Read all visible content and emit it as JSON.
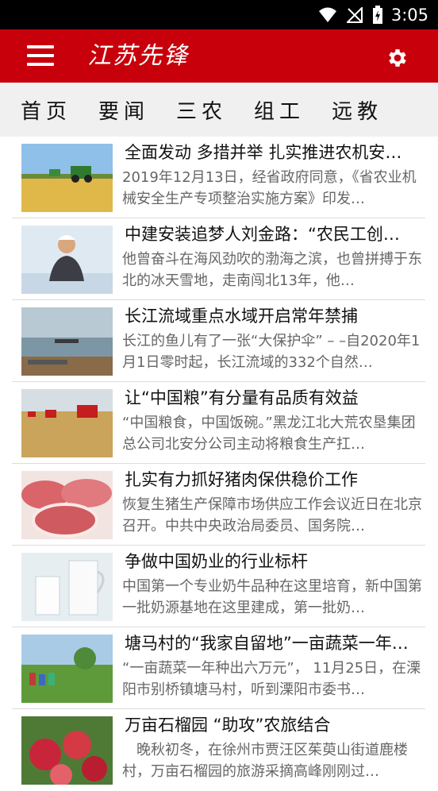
{
  "status_bar": {
    "time": "3:05"
  },
  "app_bar": {
    "logo_text": "江苏先锋"
  },
  "tabs": [
    {
      "label": "首页"
    },
    {
      "label": "要闻"
    },
    {
      "label": "三农"
    },
    {
      "label": "组工"
    },
    {
      "label": "远教"
    }
  ],
  "news": [
    {
      "title": "全面发动 多措并举 扎实推进农机安…",
      "summary": "2019年12月13日，经省政府同意，《省农业机械安全生产专项整治实施方案》印发…",
      "image": "wheat-harvest-image"
    },
    {
      "title": "中建安装追梦人刘金路：“农民工创…",
      "summary": "他曾奋斗在海风劲吹的渤海之滨，也曾拼搏于东北的冰天雪地，走南闯北13年，他…",
      "image": "worker-portrait-image"
    },
    {
      "title": "长江流域重点水域开启常年禁捕",
      "summary": "长江的鱼儿有了一张“大保护伞” – –自2020年1月1日零时起，长江流域的332个自然…",
      "image": "yangtze-river-image"
    },
    {
      "title": "让“中国粮”有分量有品质有效益",
      "summary": "“中国粮食，中国饭碗。”黑龙江北大荒农垦集团总公司北安分公司主动将粮食生产扛…",
      "image": "combine-harvesters-image"
    },
    {
      "title": "扎实有力抓好猪肉保供稳价工作",
      "summary": "恢复生猪生产保障市场供应工作会议近日在北京召开。中共中央政治局委员、国务院…",
      "image": "pork-slices-image"
    },
    {
      "title": "争做中国奶业的行业标杆",
      "summary": "中国第一个专业奶牛品种在这里培育，新中国第一批奶源基地在这里建成，第一批奶…",
      "image": "milk-glasses-image"
    },
    {
      "title": "塘马村的“我家自留地”一亩蔬菜一年…",
      "summary": "“一亩蔬菜一年种出六万元”， 11月25日，在溧阳市别桥镇塘马村，听到溧阳市委书…",
      "image": "vegetable-field-image"
    },
    {
      "title": "万亩石榴园 “助攻”农旅结合",
      "summary": "　晚秋初冬，在徐州市贾汪区茱萸山街道鹿楼村，万亩石榴园的旅游采摘高峰刚刚过…",
      "image": "pomegranate-image"
    }
  ]
}
